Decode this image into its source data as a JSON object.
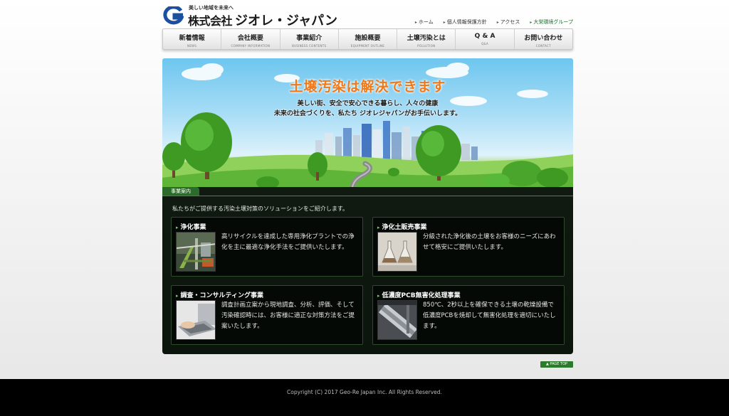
{
  "header": {
    "tagline": "美しい地域を未来へ",
    "company_prefix": "株式会社",
    "company_name": "ジオレ・ジャパン",
    "links": [
      "ホーム",
      "個人情報保護方針",
      "アクセス"
    ],
    "group_link": "大栄環境グループ"
  },
  "nav": [
    {
      "jp": "新着情報",
      "en": "NEWS"
    },
    {
      "jp": "会社概要",
      "en": "COMPANY INFORMATION"
    },
    {
      "jp": "事業紹介",
      "en": "BUSINESS CONTENTS"
    },
    {
      "jp": "施設概要",
      "en": "EQUIPMENT OUTLINE"
    },
    {
      "jp": "土壌汚染とは",
      "en": "POLLUTION"
    },
    {
      "jp": "Q & A",
      "en": "Q&A"
    },
    {
      "jp": "お問い合わせ",
      "en": "CONTACT"
    }
  ],
  "hero": {
    "title": "土壌汚染は解決できます",
    "line1": "美しい街、安全で安心できる暮らし、人々の健康",
    "line2": "未来の社会づくりを、私たち ジオレジャパンがお手伝いします。"
  },
  "business": {
    "tab": "事業案内",
    "intro": "私たちがご提供する汚染土壌対策のソリューションをご紹介します。",
    "cards": [
      {
        "title": "浄化事業",
        "text": "高リサイクルを達成した専用浄化プラントでの浄化を主に最適な浄化手法をご提供いたします。"
      },
      {
        "title": "浄化土販売事業",
        "text": "分級された浄化後の土壌をお客様のニーズにあわせて格安にご提供いたします。"
      },
      {
        "title": "調査・コンサルティング事業",
        "text": "調査計画立案から現地調査、分析、評価、そして汚染確認時には、お客様に適正な対策方法をご提案いたします。"
      },
      {
        "title": "低濃度PCB無害化処理事業",
        "text": "850℃、2秒以上を確保できる土壌の乾燥設備で低濃度PCBを焼却して無害化処理を適切にいたします。"
      }
    ]
  },
  "page_top": "PAGE TOP",
  "footer": {
    "copyright": "Copyright (C) 2017 Geo-Re Japan Inc. All Rights Reserved."
  },
  "colors": {
    "accent_orange": "#f07818",
    "brand_green": "#2d6b2d",
    "logo_blue": "#1b4fa0"
  }
}
